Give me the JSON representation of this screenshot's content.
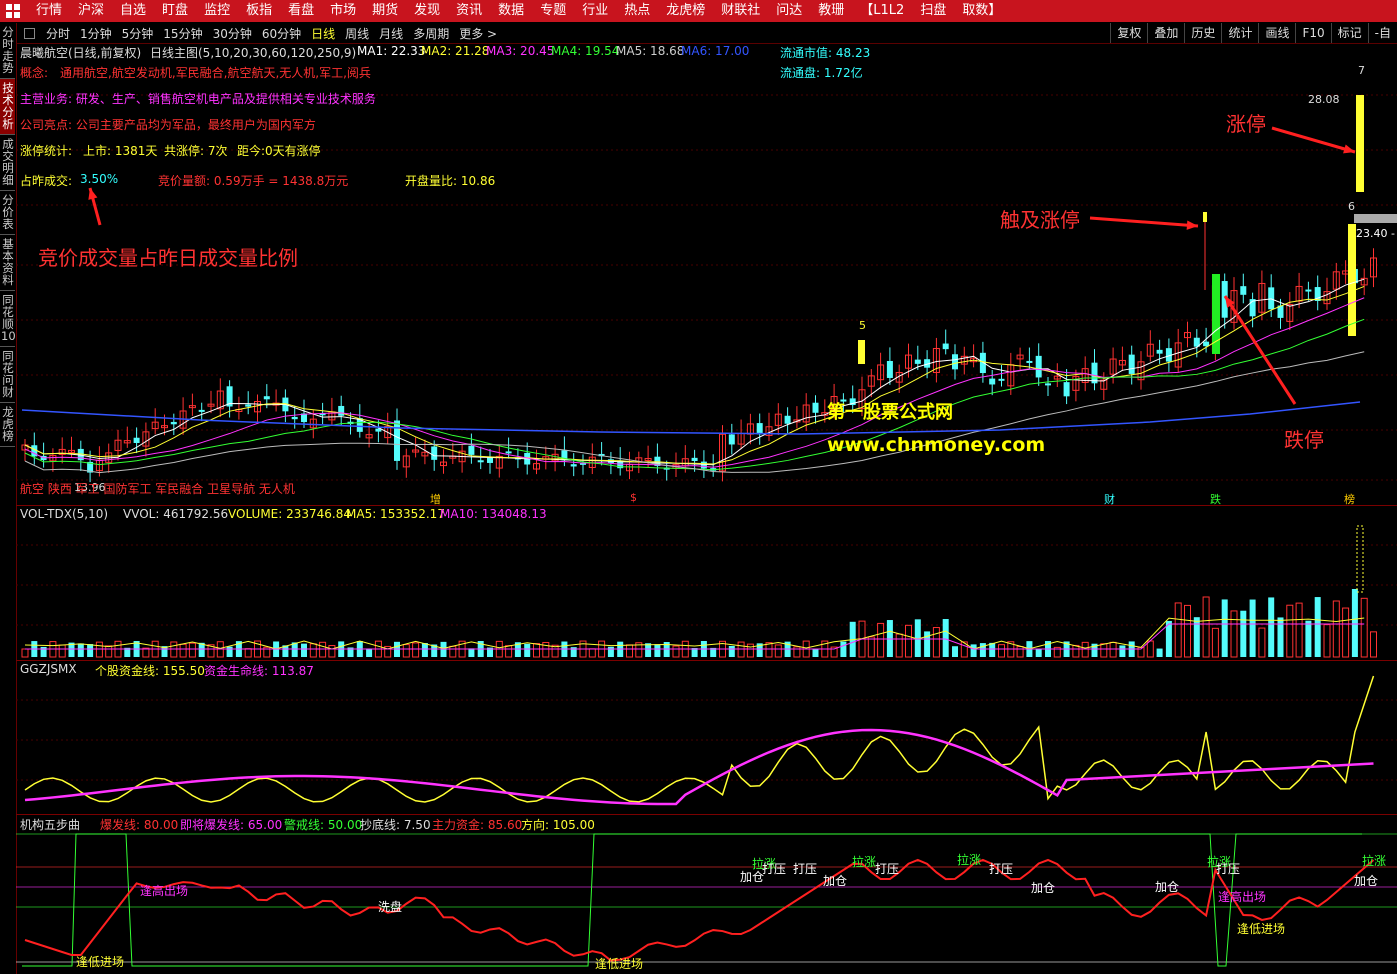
{
  "topbar": {
    "menu": [
      "行情",
      "沪深",
      "自选",
      "盯盘",
      "监控",
      "板指",
      "看盘",
      "市场",
      "期货",
      "发现",
      "资讯",
      "数据",
      "专题",
      "行业",
      "热点",
      "龙虎榜",
      "财联社",
      "问达",
      "教珊",
      "【L1L2",
      "扫盘",
      "取数】"
    ]
  },
  "periods": [
    "分时",
    "1分钟",
    "5分钟",
    "15分钟",
    "30分钟",
    "60分钟",
    "日线",
    "周线",
    "月线",
    "多周期",
    "更多 >"
  ],
  "active_period": "日线",
  "right_tools": [
    "复权",
    "叠加",
    "历史",
    "统计",
    "画线",
    "F10",
    "标记",
    "-自"
  ],
  "sidebar": [
    "分时走势",
    "技术分析",
    "成交明细",
    "分价表",
    "基本资料",
    "同花顺10",
    "同花问财",
    "龙虎榜"
  ],
  "sidebar_active": "技术分析",
  "main": {
    "title": "晨曦航空(日线,前复权)",
    "indicator": "日线主图(5,10,20,30,60,120,250,9)",
    "ma": [
      {
        "label": "MA1: 22.33",
        "color": "#ffffff"
      },
      {
        "label": "MA2: 21.28",
        "color": "#ffff33"
      },
      {
        "label": "MA3: 20.45",
        "color": "#ff33ff"
      },
      {
        "label": "MA4: 19.54",
        "color": "#33ff33"
      },
      {
        "label": "MA5: 18.68",
        "color": "#cccccc"
      },
      {
        "label": "MA6: 17.00",
        "color": "#3355ff"
      }
    ],
    "float_value": "流通市值: 48.23",
    "float_shares": "流通盘: 1.72亿",
    "concept_label": "概念:",
    "concept": "通用航空,航空发动机,军民融合,航空航天,无人机,军工,阅兵",
    "business": "主营业务: 研发、生产、销售航空机电产品及提供相关专业技术服务",
    "highlight": "公司亮点: 公司主要产品均为军品，最终用户为国内军方",
    "limit_label": "涨停统计:",
    "listed": "上市: 1381天",
    "limit_count": "共涨停: 7次",
    "since": "距今:0天有涨停",
    "ratio_label": "占昨成交:",
    "ratio_val": "3.50%",
    "auction": "竞价量额: 0.59万手 = 1438.8万元",
    "open_ratio": "开盘量比: 10.86",
    "ann_ratio": "竞价成交量占昨日成交量比例",
    "ann_limit_up": "涨停",
    "ann_touch": "触及涨停",
    "ann_limit_down": "跌停",
    "watermark1": "第一股票公式网",
    "watermark2": "www.chnmoney.com",
    "price_high": "28.08",
    "price_mid": "23.40 -",
    "price_low": "13.96",
    "num5": "5",
    "num6": "6",
    "num7": "7",
    "tags": "航空 陕西 军工 国防军工 军民融合 卫星导航 无人机",
    "markers": [
      "增",
      "$",
      "财",
      "跌",
      "榜"
    ]
  },
  "vol": {
    "name": "VOL-TDX(5,10)",
    "vvol": "VVOL: 461792.56",
    "volume": "VOLUME: 233746.84",
    "ma5": "MA5: 153352.17",
    "ma10": "MA10: 134048.13"
  },
  "fund": {
    "name": "GGZJSMX",
    "line1": "个股资金线: 155.50",
    "line2": "资金生命线: 113.87"
  },
  "five": {
    "name": "机构五步曲",
    "burst": "爆发线: 80.00",
    "near": "即将爆发线: 65.00",
    "warn": "警戒线: 50.00",
    "bottom": "抄底线: 7.50",
    "main_fund": "主力资金: 85.60",
    "dir": "方向: 105.00",
    "labels": {
      "low_entry": "逢低进场",
      "high_exit": "逢高出场",
      "wash": "洗盘",
      "add": "加仓",
      "press": "打压",
      "pull": "拉涨"
    }
  },
  "colors": {
    "up": "#ff3232",
    "down": "#54fcfc",
    "accent": "#c8141e",
    "yellow": "#ffff33",
    "magenta": "#ff33ff",
    "green": "#33ff33"
  }
}
